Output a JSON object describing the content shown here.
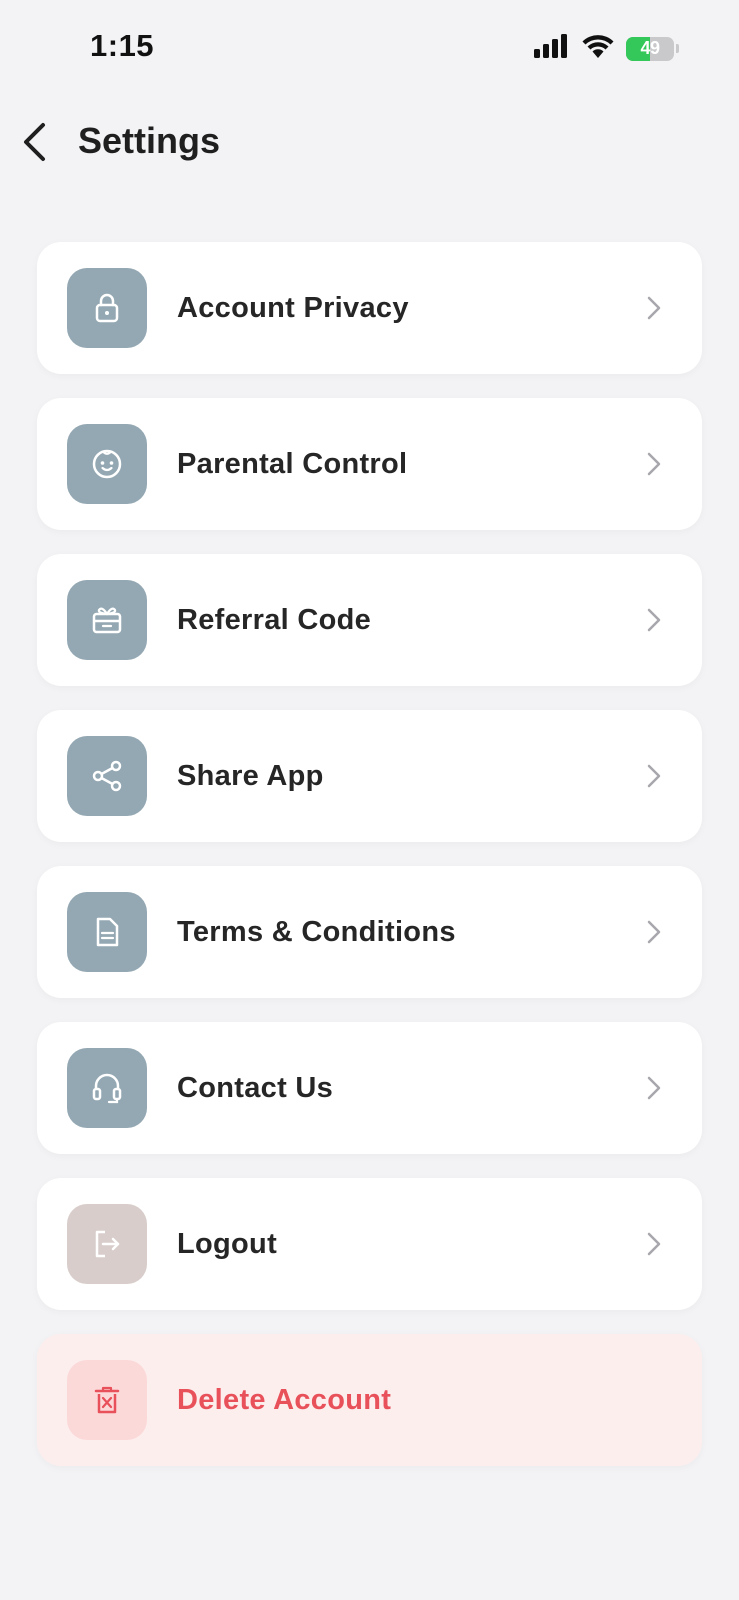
{
  "status_bar": {
    "time": "1:15",
    "battery_level": "49",
    "battery_fill_percent": 49,
    "icons": [
      "cellular-signal-icon",
      "wifi-icon",
      "battery-charging-icon"
    ]
  },
  "header": {
    "title": "Settings",
    "back_icon": "chevron-left-icon"
  },
  "colors": {
    "background": "#f3f3f5",
    "card": "#ffffff",
    "icon_tile": "#94a8b3",
    "logout_tile": "#d8cdca",
    "danger_card": "#fdeeee",
    "danger_tile": "#fcd9d9",
    "danger_text": "#e8515a",
    "battery_green": "#34c759"
  },
  "settings": {
    "items": [
      {
        "label": "Account Privacy",
        "icon": "lock-icon"
      },
      {
        "label": "Parental Control",
        "icon": "child-face-icon"
      },
      {
        "label": "Referral Code",
        "icon": "gift-icon"
      },
      {
        "label": "Share App",
        "icon": "share-icon"
      },
      {
        "label": "Terms & Conditions",
        "icon": "document-icon"
      },
      {
        "label": "Contact Us",
        "icon": "headset-icon"
      },
      {
        "label": "Logout",
        "icon": "logout-icon"
      },
      {
        "label": "Delete Account",
        "icon": "trash-icon"
      }
    ]
  }
}
